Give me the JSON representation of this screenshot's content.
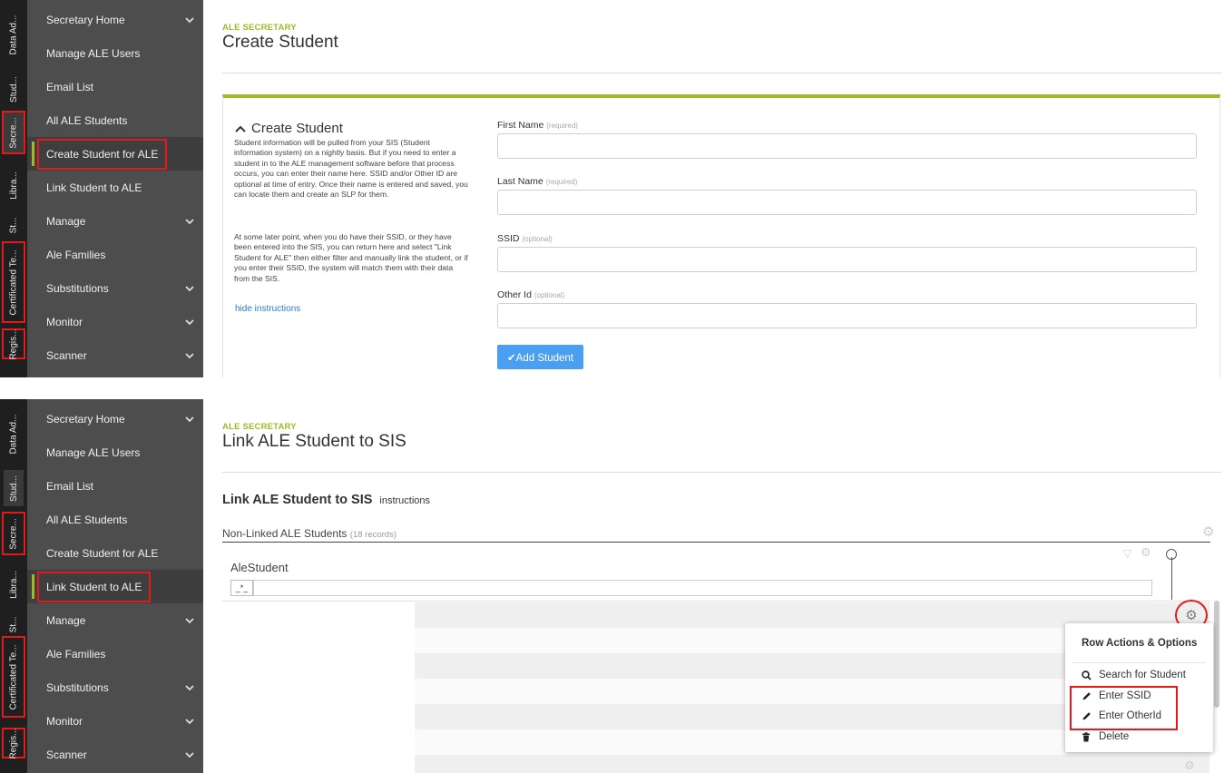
{
  "vertical_tabs": [
    "Data Ad...",
    "Stud...",
    "Secre...",
    "Libra...",
    "St...",
    "Certificated Te...",
    "Regis..."
  ],
  "sidebar": {
    "items": [
      {
        "label": "Secretary Home",
        "chevron": true
      },
      {
        "label": "Manage ALE Users",
        "chevron": false
      },
      {
        "label": "Email List",
        "chevron": false
      },
      {
        "label": "All ALE Students",
        "chevron": false
      },
      {
        "label": "Create Student for ALE",
        "chevron": false
      },
      {
        "label": "Link Student to ALE",
        "chevron": false
      },
      {
        "label": "Manage",
        "chevron": true
      },
      {
        "label": "Ale Families",
        "chevron": false
      },
      {
        "label": "Substitutions",
        "chevron": true
      },
      {
        "label": "Monitor",
        "chevron": true
      },
      {
        "label": "Scanner",
        "chevron": true
      }
    ],
    "chevron_glyph": "⌄"
  },
  "top": {
    "kicker": "ALE SECRETARY",
    "title": "Create Student",
    "card_title": "Create Student",
    "card_title_icon": "chevron-up-icon",
    "instructions_p1": "Student information will be pulled from your SIS (Student information system) on a nightly basis. But if you need to enter a student in to the ALE management software before that process occurs, you can enter their name here. SSID and/or Other ID are optional at time of entry. Once their name is entered and saved, you can locate them and create an SLP for them.",
    "instructions_p2": "At some later point, when you do have their SSID, or they have been entered into the SIS, you can return here and select \"Link Student for ALE\" then either filter and manually link the student, or if you enter their SSID, the system will match them with their data from the SIS.",
    "hide_link": "hide instructions",
    "fields": [
      {
        "label": "First Name",
        "hint": "(required)",
        "value": ""
      },
      {
        "label": "Last Name",
        "hint": "(required)",
        "value": ""
      },
      {
        "label": "SSID",
        "hint": "(optional)",
        "value": ""
      },
      {
        "label": "Other Id",
        "hint": "(optional)",
        "value": ""
      }
    ],
    "submit": "✔Add Student",
    "active_item": "Create Student for ALE",
    "accent_color": "#a3b824",
    "button_color": "#4a9ff0"
  },
  "bottom": {
    "kicker": "ALE SECRETARY",
    "title": "Link ALE Student to SIS",
    "section_title": "Link ALE Student to SIS",
    "section_link": "instructions",
    "grid_title": "Non-Linked ALE Students",
    "grid_count": "(18 records)",
    "column_header": "AleStudent",
    "filter_token": "_*_",
    "active_item": "Link Student to ALE",
    "row_menu": {
      "title": "Row Actions & Options",
      "items": [
        {
          "label": "Search for Student",
          "icon": "search-icon"
        },
        {
          "label": "Enter SSID",
          "icon": "pencil-icon"
        },
        {
          "label": "Enter OtherId",
          "icon": "pencil-icon"
        },
        {
          "label": "Delete",
          "icon": "trash-icon"
        }
      ]
    }
  },
  "highlight_color": "#e01b1b"
}
